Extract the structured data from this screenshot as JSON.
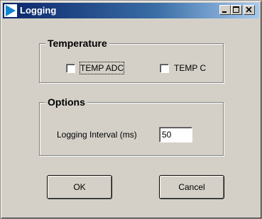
{
  "window": {
    "title": "Logging",
    "controls": {
      "minimize": "minimize-icon",
      "maximize": "maximize-icon",
      "close": "close-icon"
    }
  },
  "temperature": {
    "legend": "Temperature",
    "options": [
      {
        "label": "TEMP ADC",
        "checked": false
      },
      {
        "label": "TEMP C",
        "checked": false
      }
    ]
  },
  "options_group": {
    "legend": "Options",
    "interval_label": "Logging Interval (ms)",
    "interval_value": "50"
  },
  "buttons": {
    "ok": "OK",
    "cancel": "Cancel"
  },
  "colors": {
    "titlebar_start": "#0a246a",
    "titlebar_end": "#a6caf0",
    "face": "#d4d0c8",
    "app_icon": "#1084d0"
  }
}
